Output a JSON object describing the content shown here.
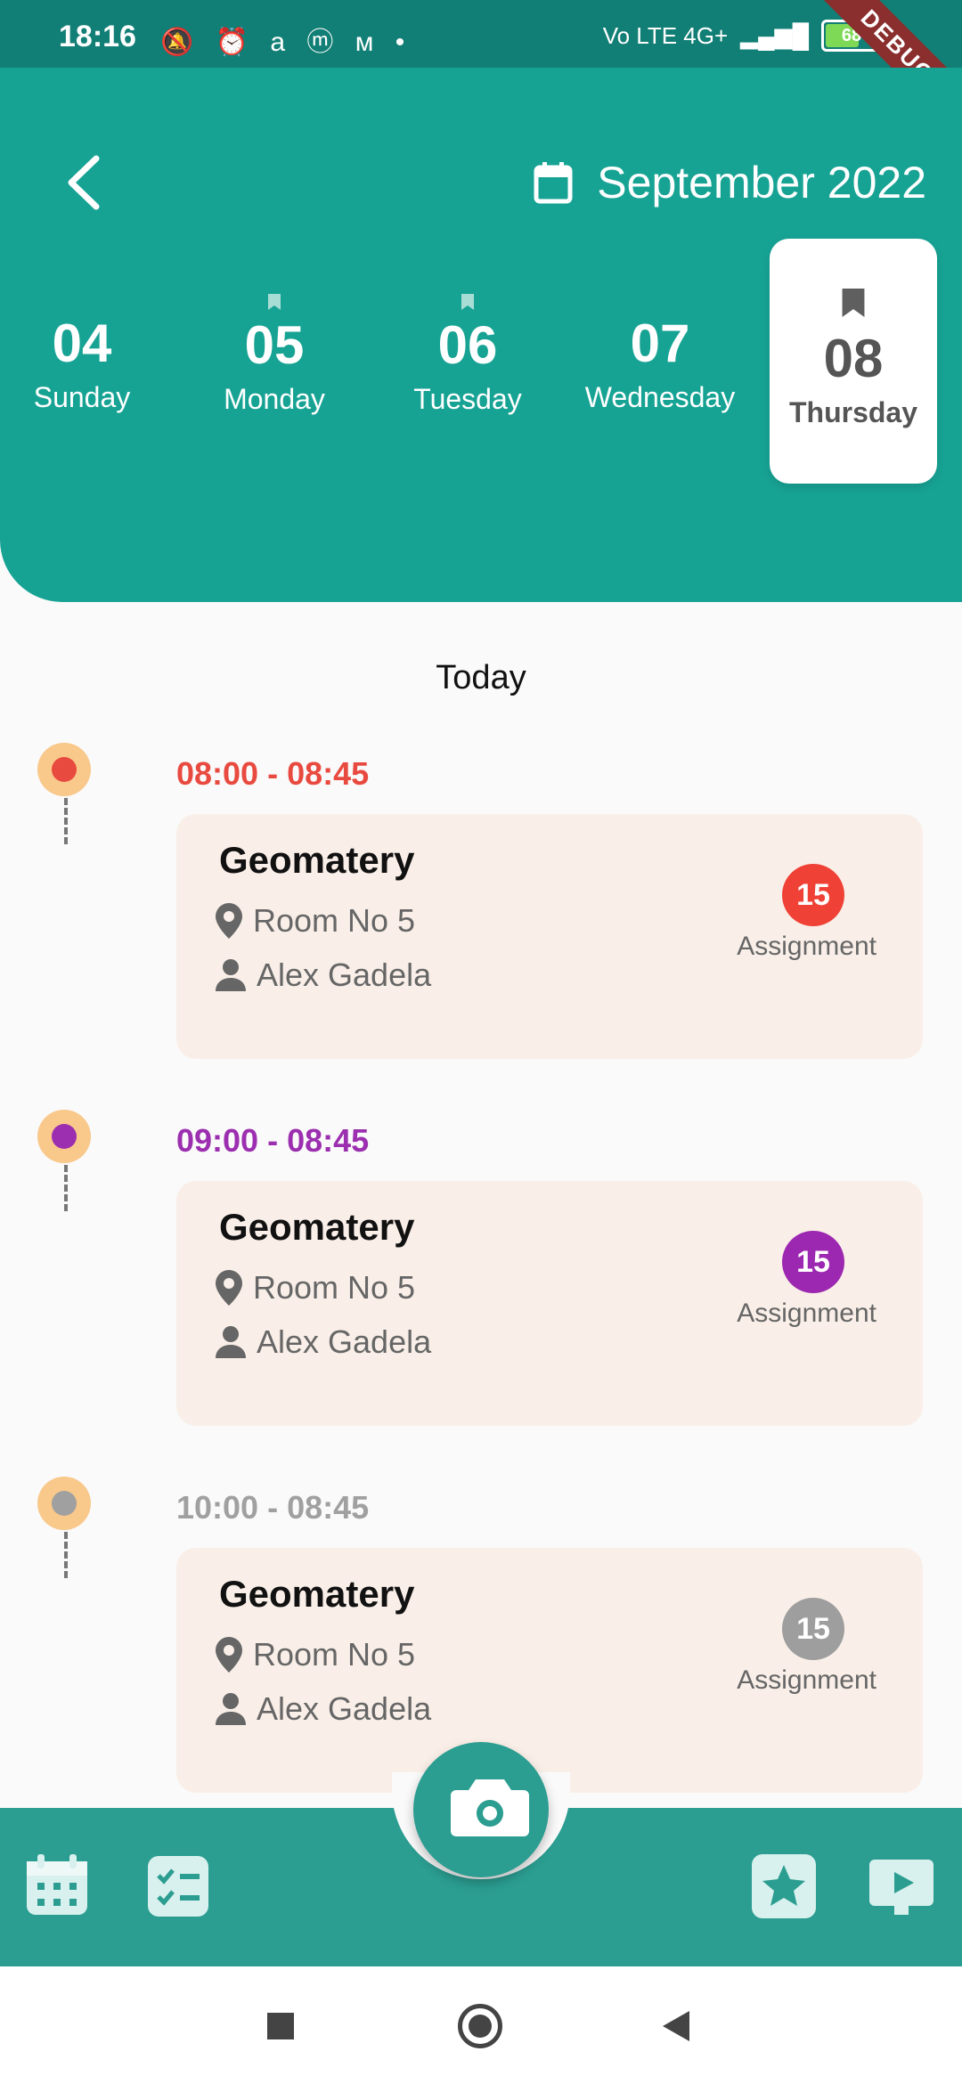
{
  "status_bar": {
    "time": "18:16",
    "left_icons": "🔕 ⏰ a ⓜ ᴍ •",
    "network": "Vo LTE 4G+",
    "battery": "68",
    "debug_label": "DEBUG"
  },
  "header": {
    "month": "September 2022",
    "days": [
      {
        "num": "04",
        "name": "Sunday"
      },
      {
        "num": "05",
        "name": "Monday"
      },
      {
        "num": "06",
        "name": "Tuesday"
      },
      {
        "num": "07",
        "name": "Wednesday"
      },
      {
        "num": "08",
        "name": "Thursday"
      }
    ]
  },
  "today_label": "Today",
  "lessons": [
    {
      "time": "08:00 - 08:45",
      "title": "Geomatery",
      "room": "Room No 5",
      "teacher": "Alex Gadela",
      "count": "15",
      "assignment_label": "Assignment",
      "color": "#e94a3f",
      "badge_color": "#ef4136"
    },
    {
      "time": "09:00 - 08:45",
      "title": "Geomatery",
      "room": "Room No 5",
      "teacher": "Alex Gadela",
      "count": "15",
      "assignment_label": "Assignment",
      "color": "#9c2fb0",
      "badge_color": "#9c27b0"
    },
    {
      "time": "10:00 - 08:45",
      "title": "Geomatery",
      "room": "Room No 5",
      "teacher": "Alex Gadela",
      "count": "15",
      "assignment_label": "Assignment",
      "color": "#a0a0a0",
      "badge_color": "#9e9e9e"
    }
  ],
  "colors": {
    "primary": "#17a394",
    "nav": "#2b9d91",
    "card": "#f9efe8"
  },
  "icons": [
    "back-icon",
    "calendar-icon",
    "bookmark-icon",
    "location-icon",
    "person-icon",
    "camera-icon",
    "schedule-icon",
    "checklist-icon",
    "star-icon",
    "video-icon"
  ]
}
